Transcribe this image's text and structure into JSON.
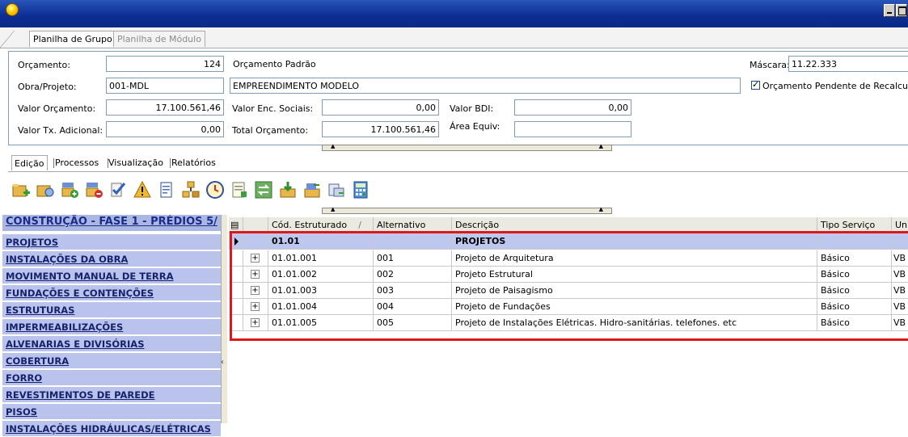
{
  "window": {
    "icon": "app-globe-icon",
    "controls": [
      "minimize",
      "maximize"
    ]
  },
  "top_tabs": [
    {
      "label": "Planilha de Grupo",
      "active": true
    },
    {
      "label": "Planilha de Módulo",
      "active": false
    }
  ],
  "header": {
    "orcamento_label": "Orçamento:",
    "orcamento_num": "124",
    "orcamento_nome": "Orçamento Padrão",
    "mascara_label": "Máscara:",
    "mascara_value": "11.22.333",
    "obra_label": "Obra/Projeto:",
    "obra_code": "001-MDL",
    "obra_nome": "EMPREENDIMENTO MODELO",
    "pendente_label": "Orçamento Pendente de Recalcul",
    "valor_orcamento_label": "Valor Orçamento:",
    "valor_orcamento": "17.100.561,46",
    "valor_enc_label": "Valor Enc. Sociais:",
    "valor_enc": "0,00",
    "valor_bdi_label": "Valor BDI:",
    "valor_bdi": "0,00",
    "valor_tx_label": "Valor Tx. Adicional:",
    "valor_tx": "0,00",
    "total_label": "Total Orçamento:",
    "total": "17.100.561,46",
    "area_label": "Área Equiv:",
    "area": ""
  },
  "lower_tabs": [
    {
      "label": "Edição",
      "active": true
    },
    {
      "label": "Processos",
      "active": false
    },
    {
      "label": "Visualização",
      "active": false
    },
    {
      "label": "Relatórios",
      "active": false
    }
  ],
  "toolbar_icons": [
    "add-folder-icon",
    "edit-folder-icon",
    "add-item-icon",
    "delete-item-icon",
    "check-edit-icon",
    "warning-icon",
    "document-search-icon",
    "hierarchy-icon",
    "clock-icon",
    "report-icon",
    "transfer-icon",
    "import-icon",
    "export-icon",
    "copy-icon",
    "calculator-icon"
  ],
  "tree": {
    "title": "CONSTRUÇÃO - FASE 1 - PRÉDIOS 5/",
    "items": [
      "PROJETOS",
      "INSTALAÇÕES DA OBRA",
      "MOVIMENTO MANUAL DE TERRA",
      "FUNDAÇÕES E CONTENÇÕES",
      "ESTRUTURAS",
      "IMPERMEABILIZAÇÕES",
      "ALVENARIAS E DIVISÓRIAS",
      "COBERTURA",
      "FORRO",
      "REVESTIMENTOS DE PAREDE",
      "PISOS",
      "INSTALAÇÕES HIDRÁULICAS/ELÉTRICAS"
    ]
  },
  "grid": {
    "headers": [
      "Cód. Estruturado",
      "Alternativo",
      "Descrição",
      "Tipo Serviço",
      "Un"
    ],
    "sort_indicator": "/",
    "group_row": {
      "code": "01.01",
      "alt": "",
      "desc": "PROJETOS",
      "tipo": "",
      "un": ""
    },
    "rows": [
      {
        "code": "01.01.001",
        "alt": "001",
        "desc": "Projeto de Arquitetura",
        "tipo": "Básico",
        "un": "VB"
      },
      {
        "code": "01.01.002",
        "alt": "002",
        "desc": "Projeto Estrutural",
        "tipo": "Básico",
        "un": "VB"
      },
      {
        "code": "01.01.003",
        "alt": "003",
        "desc": "Projeto de Paisagismo",
        "tipo": "Básico",
        "un": "VB"
      },
      {
        "code": "01.01.004",
        "alt": "004",
        "desc": "Projeto de Fundações",
        "tipo": "Básico",
        "un": "VB"
      },
      {
        "code": "01.01.005",
        "alt": "005",
        "desc": "Projeto de Instalações Elétricas. Hidro-sanitárias. telefones. etc",
        "tipo": "Básico",
        "un": "VB"
      }
    ],
    "expander_symbol": "+"
  },
  "colors": {
    "highlight": "#e0161b",
    "tree_item_bg": "#b9c3eb",
    "group_row_bg": "#bec8ee"
  }
}
